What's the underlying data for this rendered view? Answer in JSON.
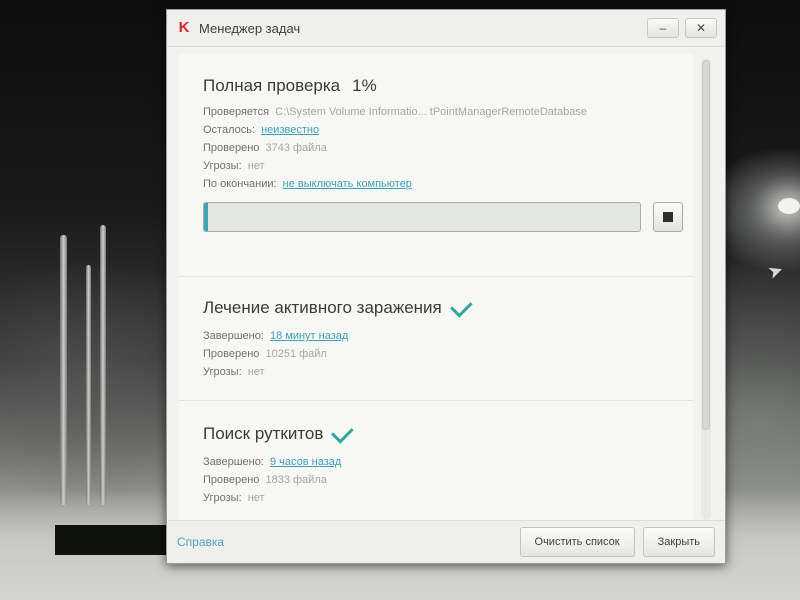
{
  "window": {
    "title": "Менеджер задач",
    "logo": "K",
    "minimize": "–",
    "close": "✕"
  },
  "tasks": {
    "full_scan": {
      "title": "Полная проверка",
      "percent": "1%",
      "progress": 0.01,
      "scanning_label": "Проверяется",
      "scanning_value": "C:\\System Volume Informatio... tPointManagerRemoteDatabase",
      "remaining_label": "Осталось:",
      "remaining_value": "неизвестно",
      "checked_label": "Проверено",
      "checked_value": "3743 файла",
      "threats_label": "Угрозы:",
      "threats_value": "нет",
      "on_finish_label": "По окончании:",
      "on_finish_value": "не выключать компьютер"
    },
    "active_infection": {
      "title": "Лечение активного заражения",
      "completed_label": "Завершено:",
      "completed_value": "18 минут назад",
      "checked_label": "Проверено",
      "checked_value": "10251 файл",
      "threats_label": "Угрозы:",
      "threats_value": "нет"
    },
    "rootkit_search": {
      "title": "Поиск руткитов",
      "completed_label": "Завершено:",
      "completed_value": "9 часов назад",
      "checked_label": "Проверено",
      "checked_value": "1833 файла",
      "threats_label": "Угрозы:",
      "threats_value": "нет"
    }
  },
  "footer": {
    "help": "Справка",
    "clear_list": "Очистить список",
    "close": "Закрыть"
  },
  "colors": {
    "accent": "#3fa5b5",
    "brand": "#d3262f",
    "check": "#2fa79a"
  }
}
